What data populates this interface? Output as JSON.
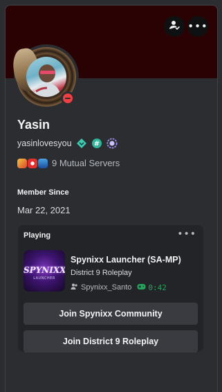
{
  "profile": {
    "display_name": "Yasin",
    "username": "yasinlovesyou",
    "mutual_servers": "9 Mutual Servers",
    "status": "dnd",
    "member_since_label": "Member Since",
    "member_since_date": "Mar 22, 2021"
  },
  "badges": [
    "hypesquad-balance-icon",
    "hashtag-icon",
    "nitro-boost-icon"
  ],
  "colors": {
    "banner": "#2a0204",
    "accent_green": "#23a55a",
    "status_red": "#f23f43"
  },
  "activity": {
    "header": "Playing",
    "game_title": "Spynixx Launcher (SA-MP)",
    "details": "District 9 Roleplay",
    "player": "Spynixx_Santo",
    "elapsed": "0:42",
    "art_logo": "SPYNIXX",
    "art_sub": "LAUNCHER",
    "buttons": [
      "Join Spynixx Community",
      "Join District 9 Roleplay"
    ]
  }
}
